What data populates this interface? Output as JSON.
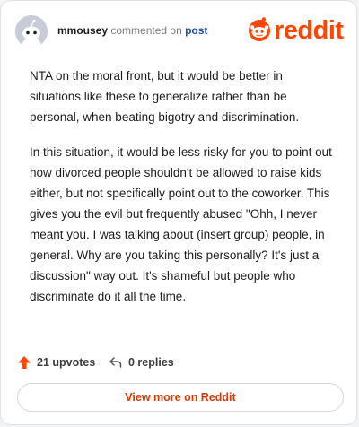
{
  "header": {
    "username": "mmousey",
    "action_text": " commented on ",
    "post_link": "post",
    "logo_text": "reddit"
  },
  "comment": {
    "paragraphs": [
      "NTA on the moral front, but it would be better in situations like these to generalize rather than be personal, when beating bigotry and discrimination.",
      "In this situation, it would be less risky for you to point out how divorced people shouldn't be allowed to raise kids either, but not specifically point out to the coworker. This gives you the evil but frequently abused \"Ohh, I never meant you. I was talking about (insert group) people, in general. Why are you taking this personally? It's just a discussion\" way out. It's shameful but people who discriminate do it all the time."
    ]
  },
  "footer": {
    "upvotes_label": "21 upvotes",
    "replies_label": "0 replies",
    "upvote_icon": "upvote-arrow-icon",
    "reply_icon": "reply-arrow-icon",
    "view_more_label": "View more on Reddit"
  },
  "colors": {
    "brand": "#ff4500",
    "link": "#1f4ea6",
    "view_more_text": "#d93a00"
  }
}
